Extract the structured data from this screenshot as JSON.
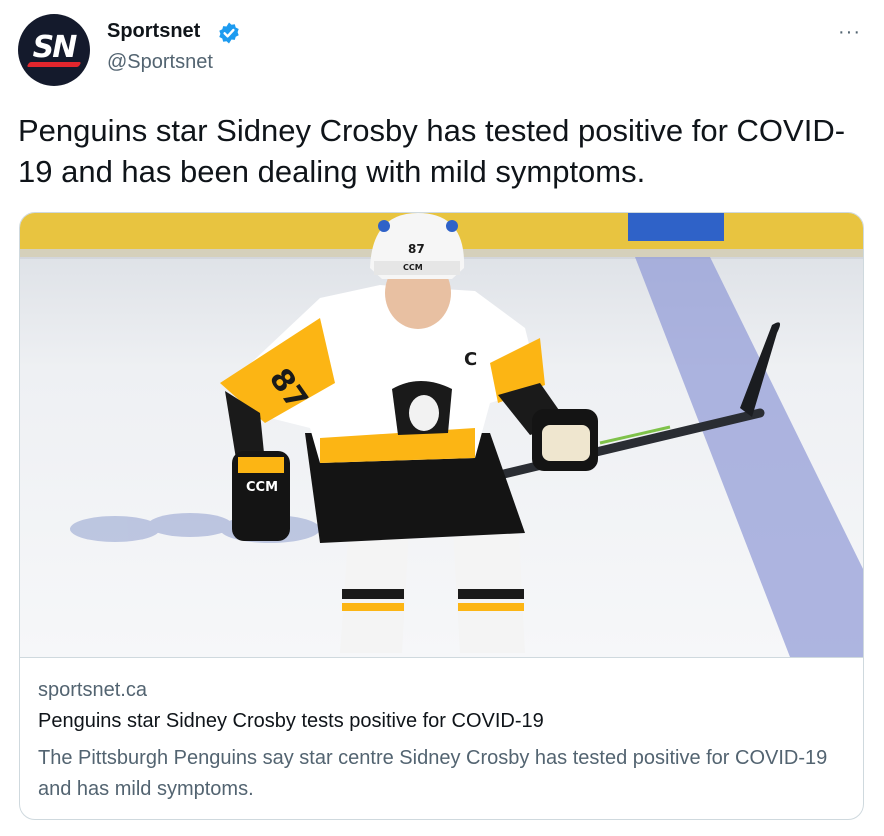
{
  "account": {
    "avatar_text": "SN",
    "display_name": "Sportsnet",
    "handle": "@Sportsnet",
    "verified": true
  },
  "more_label": "···",
  "tweet": {
    "text": "Penguins star Sidney Crosby has tested positive for COVID-19 and has been dealing with mild symptoms."
  },
  "card": {
    "domain": "sportsnet.ca",
    "title": "Penguins star Sidney Crosby tests positive for COVID-19",
    "description": "The Pittsburgh Penguins say star centre Sidney Crosby has tested positive for COVID-19 and has mild symptoms.",
    "image": {
      "jersey_number": "87",
      "helmet_number": "87",
      "captain_letter": "C",
      "helmet_brand": "CCM",
      "glove_brand": "CCM"
    }
  },
  "colors": {
    "verified_blue": "#1d9bf0",
    "penguins_gold": "#fcb514",
    "penguins_black": "#101010",
    "ice_blue_line": "#8e99d6",
    "boards_yellow": "#e8c440"
  }
}
